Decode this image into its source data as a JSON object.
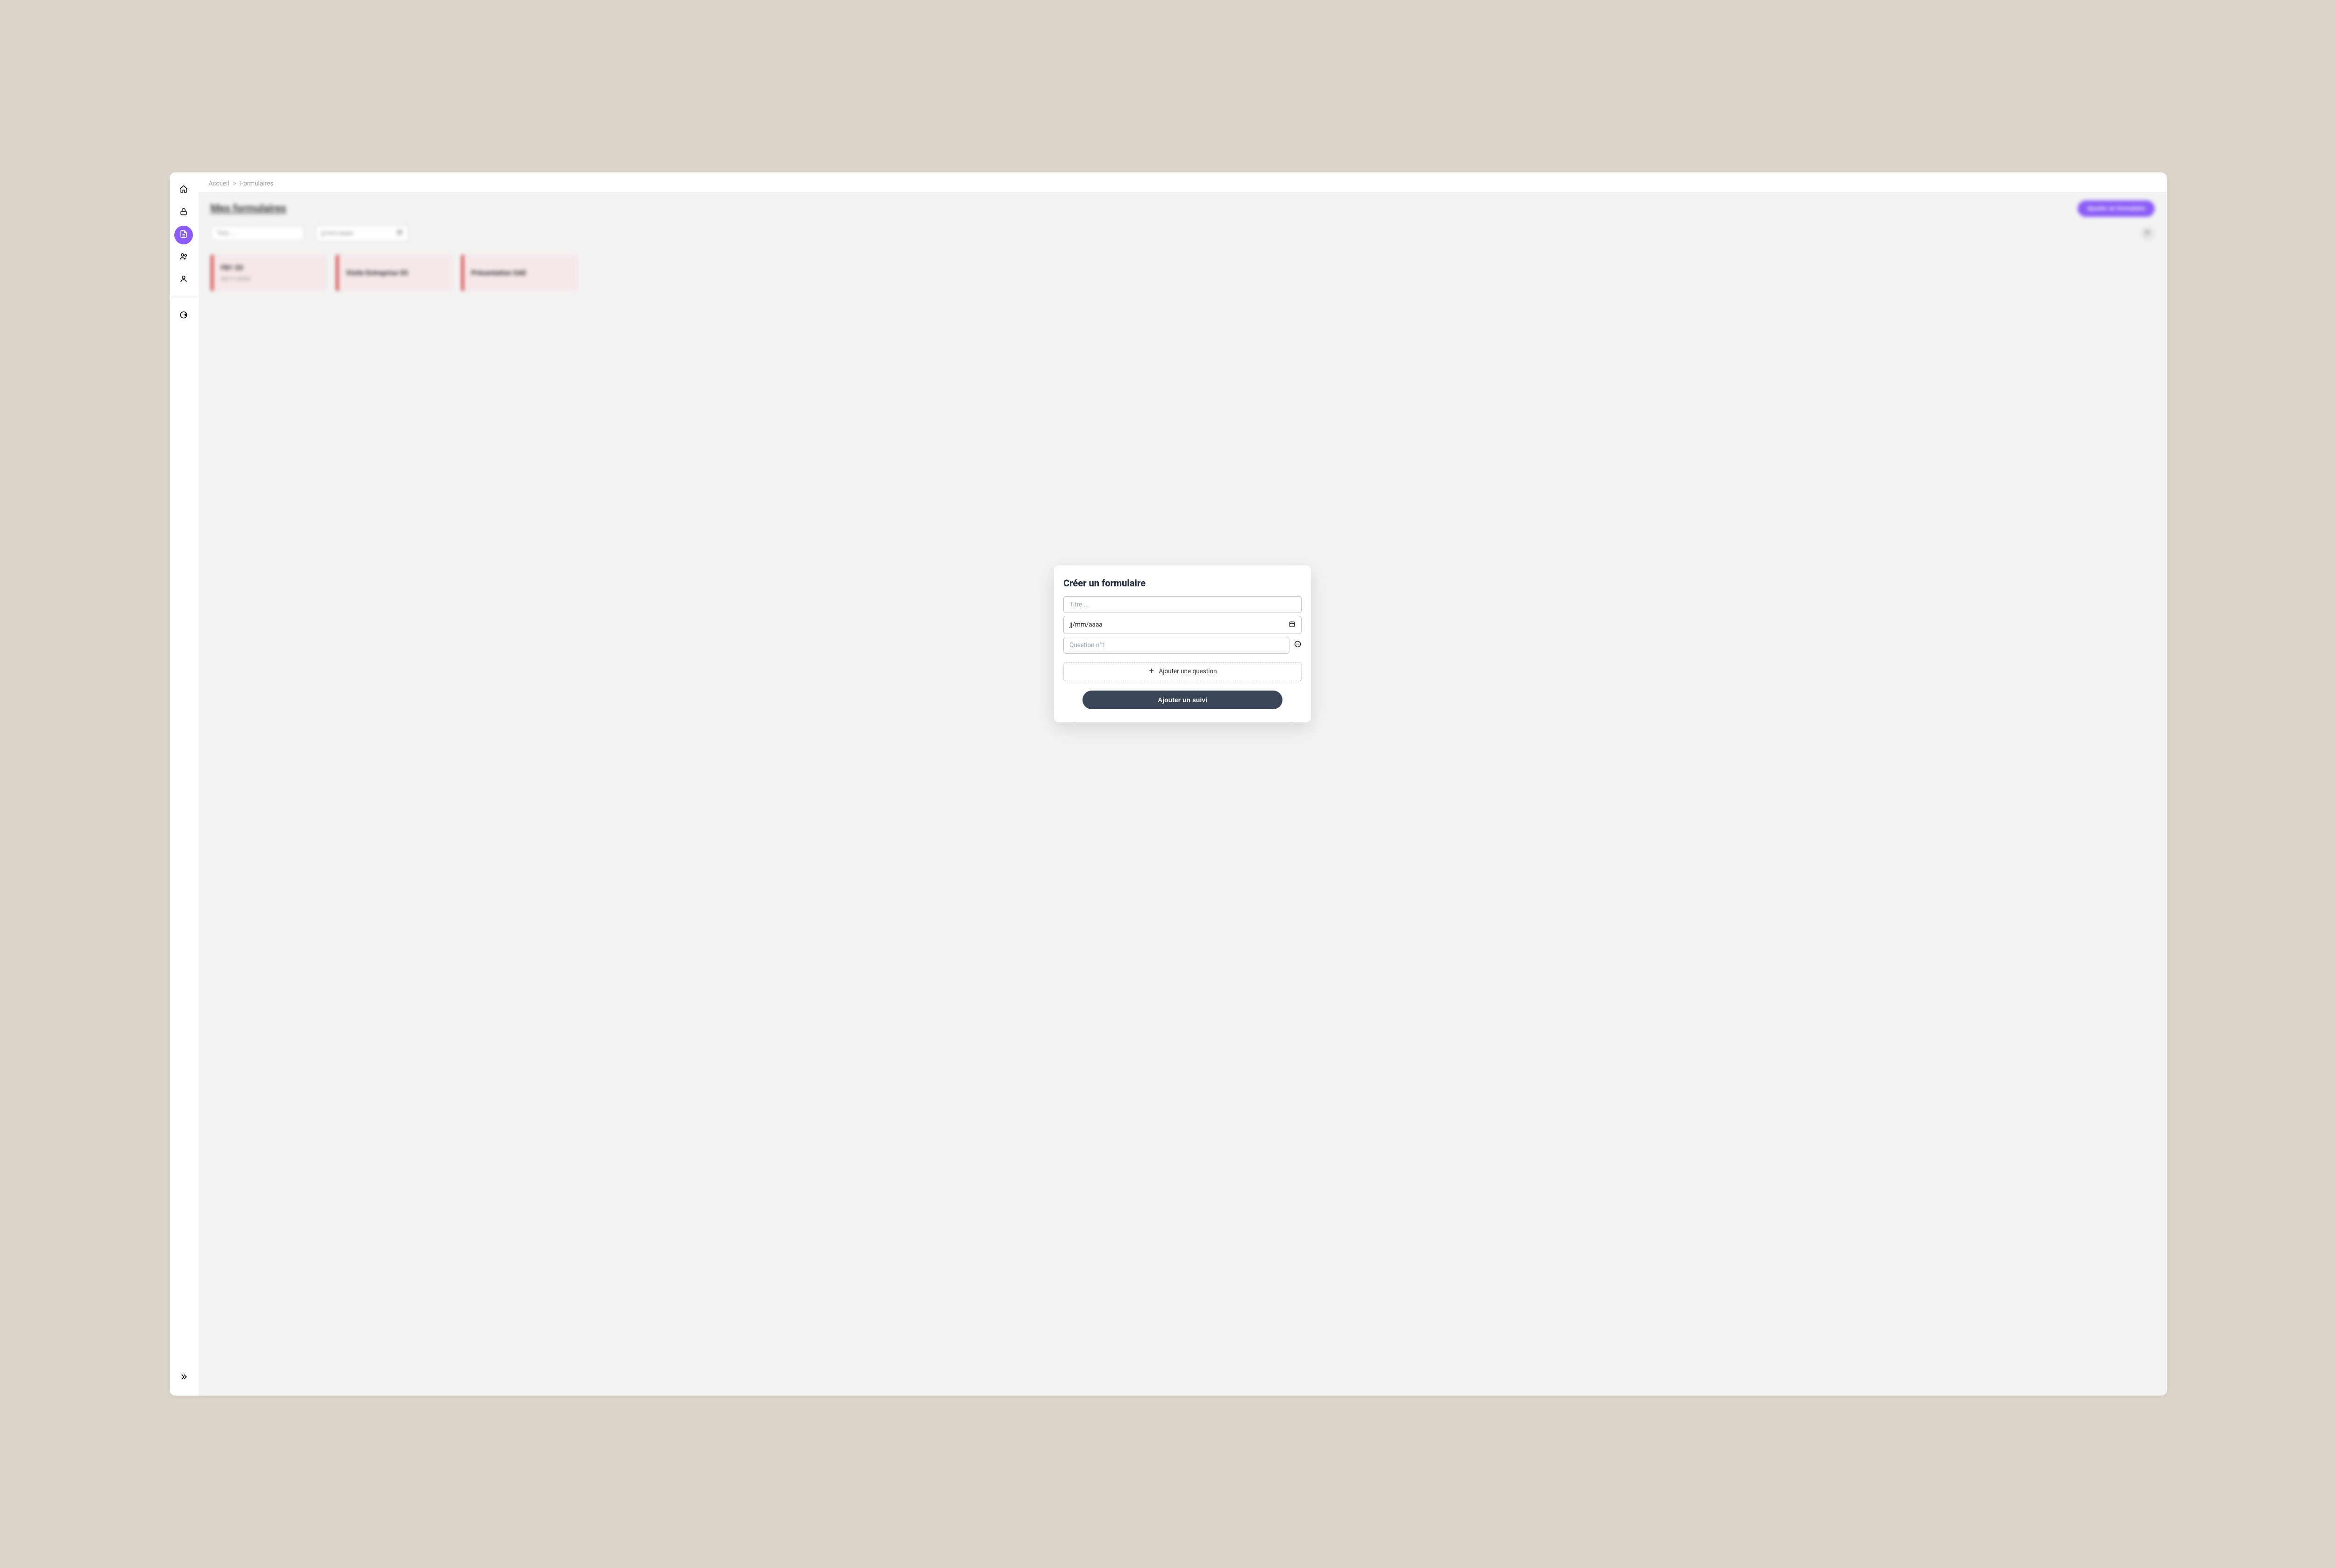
{
  "breadcrumb": {
    "home": "Accueil",
    "sep": ">",
    "current": "Formulaires"
  },
  "sidebar": {
    "home": "nav-home",
    "lock": "nav-lock",
    "doc": "nav-doc",
    "group": "nav-group",
    "person": "nav-person",
    "logout": "nav-logout",
    "expand": "nav-expand"
  },
  "background": {
    "title": "Mes formulaires",
    "add_button": "Ajouter un formulaire",
    "filter_title_placeholder": "Titre ...",
    "filter_date_placeholder": "jj/mm/aaaa",
    "cards": [
      {
        "title": "FB1 S5",
        "date": "20/11/2023"
      },
      {
        "title": "Visite Entreprise S5",
        "date": ""
      },
      {
        "title": "Présentation SAE",
        "date": ""
      }
    ]
  },
  "modal": {
    "title": "Créer un formulaire",
    "title_placeholder": "Titre ...",
    "date_placeholder": "jj/mm/aaaa",
    "question1_placeholder": "Question n°1",
    "add_question": "Ajouter une question",
    "submit": "Ajouter un suivi"
  },
  "colors": {
    "accent_purple": "#8b5cf6",
    "dark_slate": "#3a4657",
    "card_red": "#d14b4b",
    "page_bg": "#dbd5cc"
  }
}
